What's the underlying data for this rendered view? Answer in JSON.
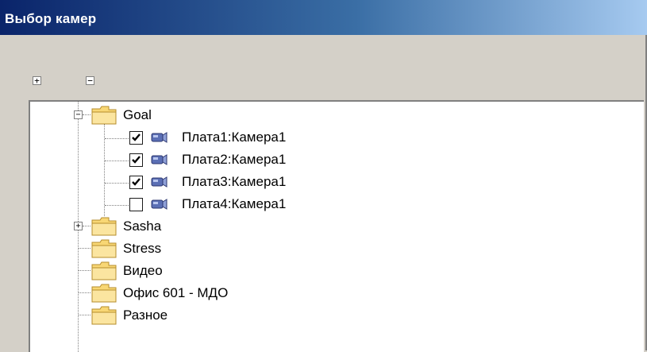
{
  "window": {
    "title": "Выбор камер"
  },
  "toolbar": {
    "expand_all_glyph": "+",
    "collapse_all_glyph": "−"
  },
  "tree": {
    "groups": [
      {
        "label": "Goal",
        "expanded": true,
        "icon": "folder-icon",
        "children": [
          {
            "label": "Плата1:Камера1",
            "checked": true,
            "icon": "camera-icon"
          },
          {
            "label": "Плата2:Камера1",
            "checked": true,
            "icon": "camera-icon"
          },
          {
            "label": "Плата3:Камера1",
            "checked": true,
            "icon": "camera-icon"
          },
          {
            "label": "Плата4:Камера1",
            "checked": false,
            "icon": "camera-icon"
          }
        ]
      },
      {
        "label": "Sasha",
        "expanded": false,
        "icon": "folder-icon"
      },
      {
        "label": "Stress",
        "icon": "folder-icon"
      },
      {
        "label": "Видео",
        "icon": "folder-icon"
      },
      {
        "label": "Офис 601 - МДО",
        "icon": "folder-icon"
      },
      {
        "label": "Разное",
        "icon": "folder-icon"
      }
    ]
  },
  "colors": {
    "title_start": "#0a246a",
    "title_end": "#a6caf0",
    "folder_yellow": "#f8d775",
    "window_face": "#d4d0c8"
  }
}
